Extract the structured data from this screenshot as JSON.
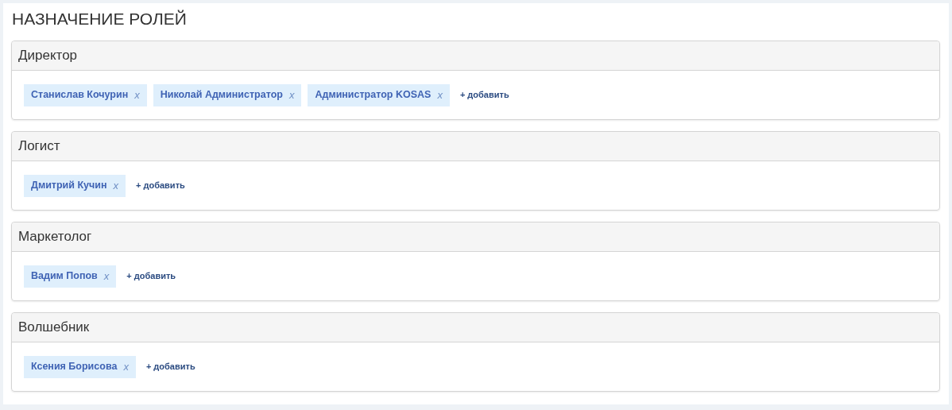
{
  "title": "НАЗНАЧЕНИЕ РОЛЕЙ",
  "roles": [
    {
      "name": "Директор",
      "members": [
        {
          "name": "Станислав Кочурин",
          "remove": "x"
        },
        {
          "name": "Николай Администратор",
          "remove": "x"
        },
        {
          "name": "Администратор KOSAS",
          "remove": "x"
        }
      ],
      "add": "+ добавить"
    },
    {
      "name": "Логист",
      "members": [
        {
          "name": "Дмитрий Кучин",
          "remove": "x"
        }
      ],
      "add": "+ добавить"
    },
    {
      "name": "Маркетолог",
      "members": [
        {
          "name": "Вадим Попов",
          "remove": "x"
        }
      ],
      "add": "+ добавить"
    },
    {
      "name": "Волшебник",
      "members": [
        {
          "name": "Ксения Борисова",
          "remove": "x"
        }
      ],
      "add": "+ добавить"
    }
  ]
}
